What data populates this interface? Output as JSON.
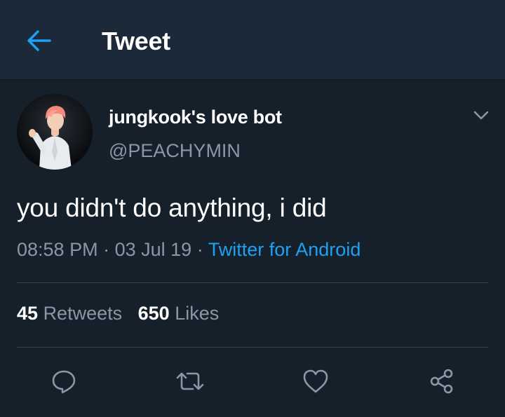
{
  "header": {
    "title": "Tweet",
    "back_icon": "arrow-left-icon",
    "accent": "#1da1f2"
  },
  "tweet": {
    "author": {
      "display_name": "jungkook's love bot",
      "handle": "@PEACHYMIN"
    },
    "text": "you didn't do anything, i did",
    "time": "08:58 PM",
    "date": "03 Jul 19",
    "separator": "·",
    "source": "Twitter for Android",
    "retweets_count": "45",
    "retweets_label": "Retweets",
    "likes_count": "650",
    "likes_label": "Likes",
    "menu_icon": "chevron-down-icon"
  },
  "actions": [
    {
      "name": "reply",
      "icon": "speech-bubble-icon"
    },
    {
      "name": "retweet",
      "icon": "retweet-arrows-icon"
    },
    {
      "name": "like",
      "icon": "heart-icon"
    },
    {
      "name": "share",
      "icon": "share-nodes-icon"
    }
  ],
  "colors": {
    "background": "#15202b",
    "header_background": "#1c2938",
    "text": "#ffffff",
    "secondary_text": "#8899a6",
    "link": "#1da1f2",
    "divider": "#38444d"
  }
}
